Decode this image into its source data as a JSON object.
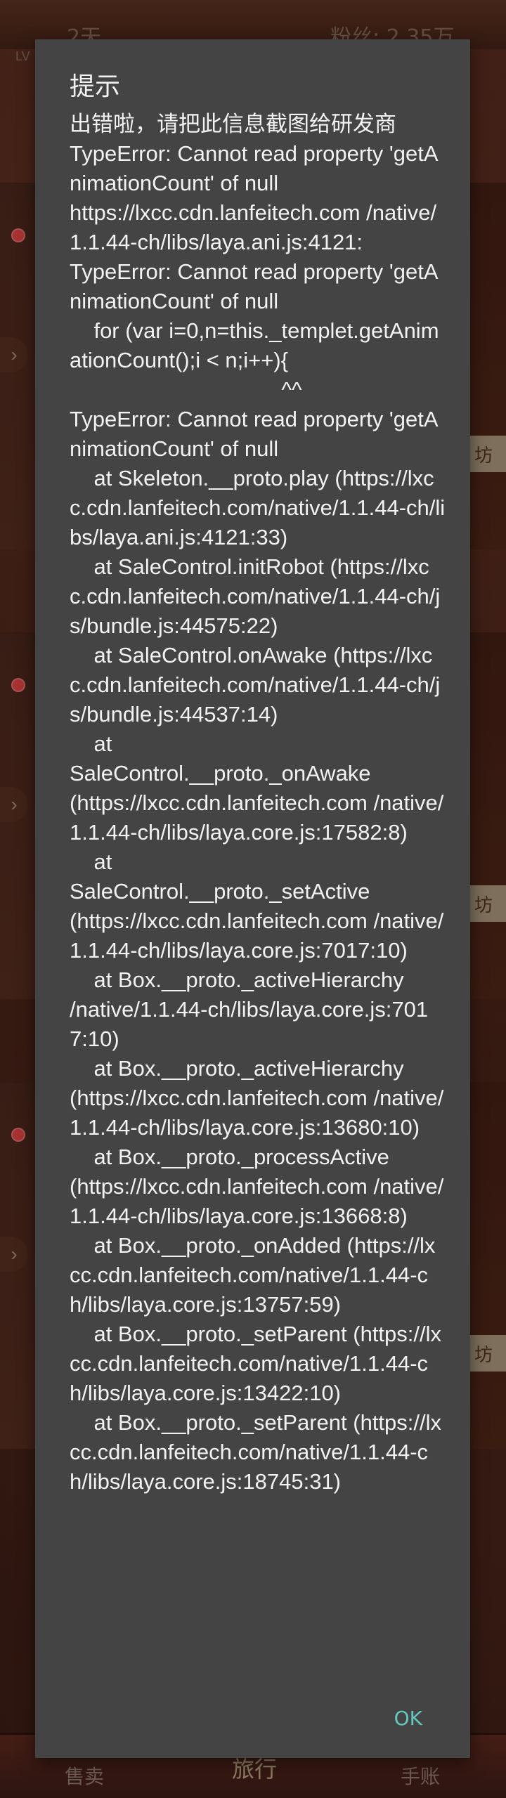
{
  "background": {
    "days_text": "2天",
    "fans_text": "粉丝: 2.35万",
    "level_text": "LV",
    "badges": [
      "坊",
      "坊",
      "坊"
    ],
    "tabs": {
      "sell": "售卖",
      "travel": "旅行",
      "ledger": "手账"
    }
  },
  "dialog": {
    "title": "提示",
    "message": "出错啦，请把此信息截图给研发商\nTypeError: Cannot read property 'getAnimationCount' of null\nhttps://lxcc.cdn.lanfeitech.com /native/1.1.44-ch/libs/laya.ani.js:4121:\nTypeError: Cannot read property 'getAnimationCount' of null\n    for (var i=0,n=this._templet.getAnimationCount();i < n;i++){\n                                   ^^\nTypeError: Cannot read property 'getAnimationCount' of null\n    at Skeleton.__proto.play (https://lxcc.cdn.lanfeitech.com/native/1.1.44-ch/libs/laya.ani.js:4121:33)\n    at SaleControl.initRobot (https://lxcc.cdn.lanfeitech.com/native/1.1.44-ch/js/bundle.js:44575:22)\n    at SaleControl.onAwake (https://lxcc.cdn.lanfeitech.com/native/1.1.44-ch/js/bundle.js:44537:14)\n    at\nSaleControl.__proto._onAwake\n(https://lxcc.cdn.lanfeitech.com /native/1.1.44-ch/libs/laya.core.js:17582:8)\n    at\nSaleControl.__proto._setActive\n(https://lxcc.cdn.lanfeitech.com /native/1.1.44-ch/libs/laya.core.js:7017:10)\n    at Box.__proto._activeHierarchy\n/native/1.1.44-ch/libs/laya.core.js:7017:10)\n    at Box.__proto._activeHierarchy\n(https://lxcc.cdn.lanfeitech.com /native/1.1.44-ch/libs/laya.core.js:13680:10)\n    at Box.__proto._processActive\n(https://lxcc.cdn.lanfeitech.com /native/1.1.44-ch/libs/laya.core.js:13668:8)\n    at Box.__proto._onAdded (https://lxcc.cdn.lanfeitech.com/native/1.1.44-ch/libs/laya.core.js:13757:59)\n    at Box.__proto._setParent (https://lxcc.cdn.lanfeitech.com/native/1.1.44-ch/libs/laya.core.js:13422:10)\n    at Box.__proto._setParent (https://lxcc.cdn.lanfeitech.com/native/1.1.44-ch/libs/laya.core.js:18745:31)",
    "ok_label": "OK"
  }
}
